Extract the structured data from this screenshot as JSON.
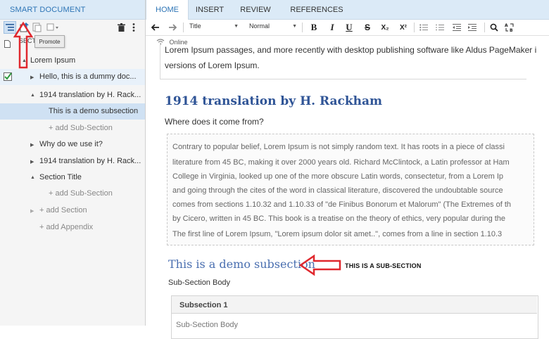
{
  "left_panel": {
    "title": "SMART DOCUMENT",
    "tooltip": "Promote",
    "section_header_label": "SECT",
    "tree": [
      {
        "label": "Lorem Ipsum",
        "expander": "▲"
      },
      {
        "label": "Hello, this is a dummy doc...",
        "expander": "▶"
      },
      {
        "label": "1914 translation by H. Rack...",
        "expander": "▲"
      },
      {
        "label": "This is a demo subsection",
        "expander": ""
      },
      {
        "label": "+ add Sub-Section",
        "expander": ""
      },
      {
        "label": "Why do we use it?",
        "expander": "▶"
      },
      {
        "label": "1914 translation by H. Rack...",
        "expander": "▶"
      },
      {
        "label": "Section Title",
        "expander": "▲"
      },
      {
        "label": "+ add Sub-Section",
        "expander": ""
      },
      {
        "label": "+ add Section",
        "expander": "▶"
      },
      {
        "label": "+ add Appendix",
        "expander": ""
      }
    ]
  },
  "tabs": [
    "HOME",
    "INSERT",
    "REVIEW",
    "REFERENCES"
  ],
  "toolbar": {
    "style_select": "Title",
    "para_select": "Normal",
    "bold": "B",
    "italic": "I",
    "underline": "U",
    "strike": "S",
    "subscript": "X₂",
    "superscript": "X²"
  },
  "document": {
    "status": "Online",
    "intro_line1": "Lorem Ipsum passages, and more recently with desktop publishing software like Aldus PageMaker i",
    "intro_line2": "versions of Lorem Ipsum.",
    "heading": "1914 translation by H. Rackham",
    "question": "Where does it come from?",
    "quote_lines": [
      "Contrary to popular belief, Lorem Ipsum is not simply random text. It has roots in a piece of classi",
      "literature from 45 BC, making it over 2000 years old. Richard McClintock, a Latin professor at Ham",
      "College in Virginia, looked up one of the more obscure Latin words, consectetur, from a Lorem Ip",
      "and going through the cites of the word in classical literature, discovered the undoubtable source",
      "comes from sections 1.10.32 and 1.10.33 of \"de Finibus Bonorum et Malorum\" (The Extremes of th",
      "by Cicero, written in 45 BC. This book is a treatise on the theory of ethics, very popular during the",
      "The first line of Lorem Ipsum, \"Lorem ipsum dolor sit amet..\", comes from a line in section 1.10.3"
    ],
    "subsection_heading": "This is a demo subsection",
    "subsection_body": "Sub-Section Body",
    "subsection_box_title": "Subsection 1",
    "subsection_box_body": "Sub-Section Body"
  },
  "annotation": {
    "label": "THIS IS A SUB-SECTION",
    "arrow_color": "#e0282e"
  },
  "colors": {
    "accent": "#2e75b6",
    "header_bg": "#dbeaf7",
    "selected_row": "#cfe1f3",
    "heading": "#2f5496"
  }
}
